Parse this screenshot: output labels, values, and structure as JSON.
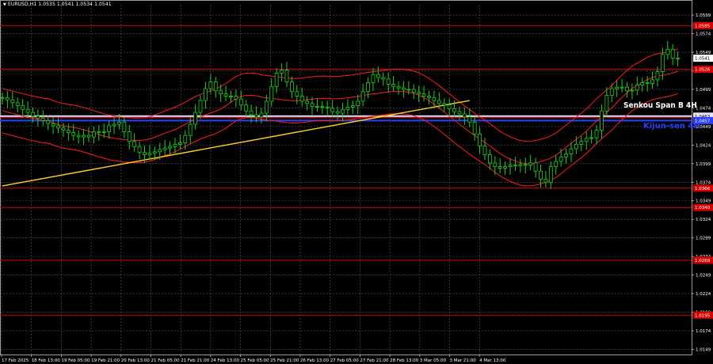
{
  "header": {
    "symbol_text": "EURUSD,H1  1.0535 1.0541 1.0534 1.0541"
  },
  "colors": {
    "background": "#000000",
    "grid": "#5a5a5a",
    "level_red": "#d40000",
    "candle": "#19d419",
    "ichimoku_band": "#ff1a1a",
    "trendline": "#ffd21f",
    "senkou_span_b": "#e8e2ff",
    "kijun_sen": "#2a40ff",
    "axis_text": "#ffffff"
  },
  "chart_data": {
    "type": "candlestick",
    "symbol": "EURUSD",
    "timeframe": "H1",
    "y_ticks": [
      "1.0599",
      "1.0574",
      "1.0549",
      "1.0524",
      "1.0499",
      "1.0474",
      "1.0449",
      "1.0424",
      "1.0399",
      "1.0374",
      "1.0349",
      "1.0324",
      "1.0299",
      "1.0274",
      "1.0249",
      "1.0224",
      "1.0199",
      "1.0174",
      "1.0149"
    ],
    "ylim": [
      1.0142,
      1.0613
    ],
    "x_ticks": [
      "17 Feb 2025",
      "18 Feb 13:00",
      "19 Feb 05:00",
      "19 Feb 21:00",
      "20 Feb 13:00",
      "21 Feb 05:00",
      "21 Feb 21:00",
      "24 Feb 13:00",
      "25 Feb 05:00",
      "25 Feb 21:00",
      "26 Feb 13:00",
      "27 Feb 05:00",
      "27 Feb 21:00",
      "28 Feb 13:00",
      "3 Mar 05:00",
      "3 Mar 21:00",
      "4 Mar 13:00"
    ],
    "price_levels": [
      {
        "value": 1.0585,
        "label": "1.0585"
      },
      {
        "value": 1.0526,
        "label": "1.0526"
      },
      {
        "value": 1.0461,
        "label": "1.0461"
      },
      {
        "value": 1.0366,
        "label": "1.0366"
      },
      {
        "value": 1.034,
        "label": "1.0340"
      },
      {
        "value": 1.0269,
        "label": "1.0269"
      },
      {
        "value": 1.0195,
        "label": "1.0195"
      }
    ],
    "current_price": {
      "value": 1.0541,
      "label": "1.0541"
    },
    "senkou_span_b": {
      "name": "Senkou Span B 4H",
      "value": 1.0463,
      "label": "1.0463"
    },
    "kijun_sen": {
      "name": "Kijun-sen 4H",
      "value": 1.0457,
      "label": "1.0457"
    },
    "trendline": {
      "start": [
        0,
        1.0369
      ],
      "end": [
        92,
        1.0484
      ]
    },
    "closes": [
      1.0488,
      1.0485,
      1.0481,
      1.0477,
      1.0472,
      1.0468,
      1.0463,
      1.046,
      1.0457,
      1.0453,
      1.045,
      1.0447,
      1.0444,
      1.0441,
      1.0437,
      1.0435,
      1.0437,
      1.0435,
      1.0442,
      1.0441,
      1.0442,
      1.045,
      1.0452,
      1.0455,
      1.0442,
      1.0429,
      1.0422,
      1.0414,
      1.0411,
      1.0413,
      1.0415,
      1.0418,
      1.042,
      1.0422,
      1.0425,
      1.0427,
      1.0437,
      1.0452,
      1.0468,
      1.0484,
      1.05,
      1.0509,
      1.0497,
      1.0493,
      1.049,
      1.049,
      1.0486,
      1.0478,
      1.047,
      1.0465,
      1.0462,
      1.0467,
      1.0483,
      1.0503,
      1.0521,
      1.0525,
      1.0509,
      1.0496,
      1.049,
      1.0483,
      1.048,
      1.0476,
      1.0476,
      1.0475,
      1.0474,
      1.0469,
      1.0467,
      1.0472,
      1.0475,
      1.0477,
      1.0483,
      1.0496,
      1.0508,
      1.0519,
      1.0515,
      1.0513,
      1.0506,
      1.0503,
      1.0501,
      1.0499,
      1.0499,
      1.0495,
      1.0493,
      1.049,
      1.0488,
      1.0484,
      1.048,
      1.0478,
      1.0473,
      1.0469,
      1.0466,
      1.0462,
      1.0455,
      1.0439,
      1.0423,
      1.0411,
      1.04,
      1.0395,
      1.0393,
      1.0395,
      1.0397,
      1.0396,
      1.0398,
      1.0397,
      1.04,
      1.0389,
      1.0378,
      1.0374,
      1.0395,
      1.0402,
      1.0408,
      1.0412,
      1.0419,
      1.0425,
      1.0429,
      1.0433,
      1.0434,
      1.0444,
      1.047,
      1.0491,
      1.05,
      1.0502,
      1.0502,
      1.0497,
      1.0498,
      1.0505,
      1.0508,
      1.0507,
      1.0512,
      1.0523,
      1.0546,
      1.0553,
      1.0541,
      1.0541
    ]
  }
}
